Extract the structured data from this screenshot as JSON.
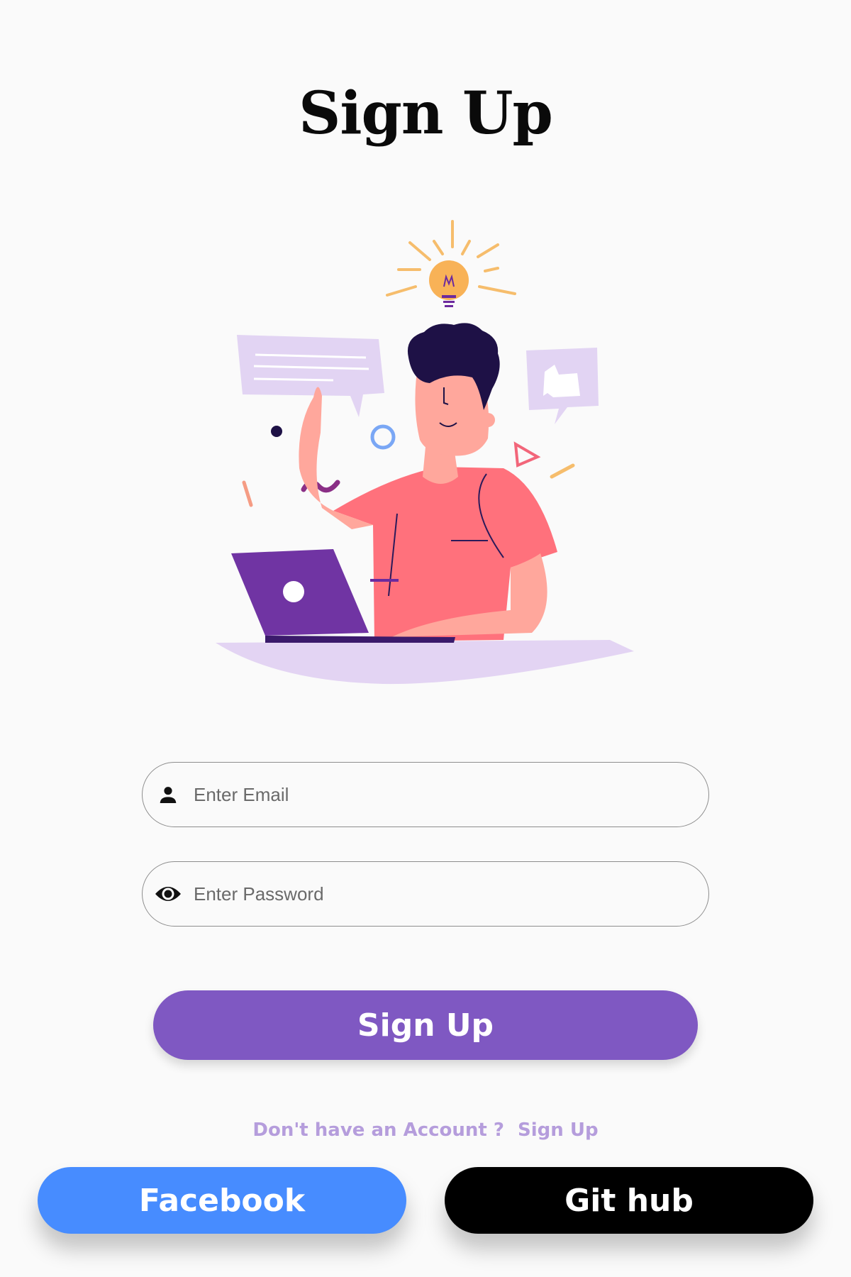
{
  "page": {
    "title": "Sign Up"
  },
  "form": {
    "email": {
      "placeholder": "Enter Email",
      "value": "",
      "icon": "person-icon"
    },
    "password": {
      "placeholder": "Enter Password",
      "value": "",
      "icon": "eye-icon"
    },
    "submit_label": "Sign Up"
  },
  "account_prompt": {
    "text": "Don't have an Account ?",
    "link_label": "Sign Up"
  },
  "social": {
    "facebook_label": "Facebook",
    "github_label": "Git hub"
  },
  "colors": {
    "primary": "#7f58c2",
    "facebook": "#478cff",
    "github": "#000000",
    "link": "#b59ddc",
    "background": "#fafafa"
  }
}
